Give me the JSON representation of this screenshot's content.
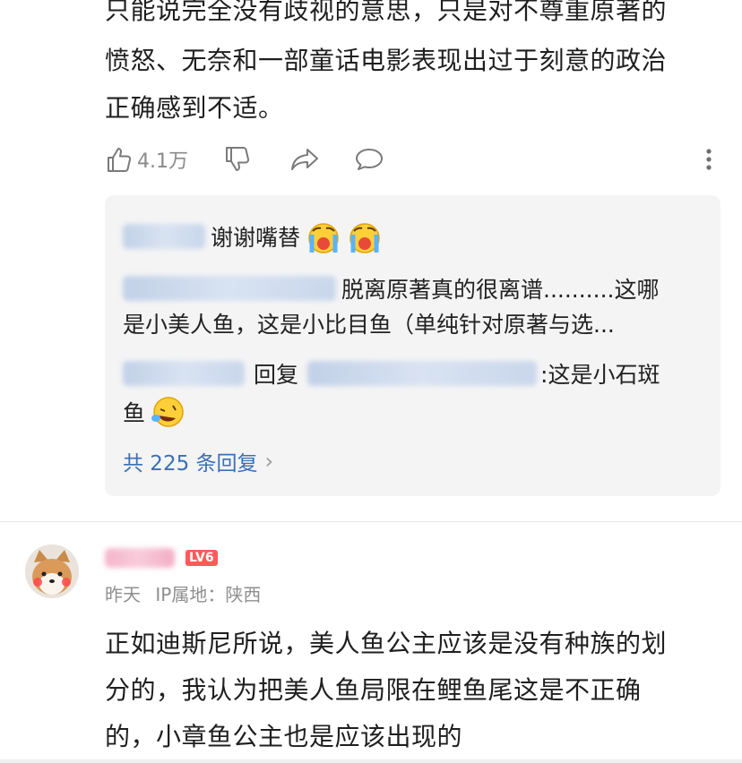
{
  "comment_top": {
    "lines": [
      "只能说完全没有歧视的意思，只是对不尊重原著的",
      "愤怒、无奈和一部童话电影表现出过于刻意的政治",
      "正确感到不适。"
    ],
    "likes": "4.1万"
  },
  "replies": {
    "r1_text": "谢谢嘴替",
    "r2_text_a": "脱离原著真的很离谱..........这哪",
    "r2_text_b": "是小美人鱼，这是小比目鱼（单纯针对原著与选...",
    "r3_reply_word": "回复",
    "r3_text_a": ":这是小石斑",
    "r3_text_b": "鱼",
    "more_label": "共 225 条回复",
    "more_chevron": "›"
  },
  "comment2": {
    "level": "LV6",
    "time": "昨天",
    "ip_label": "IP属地：陕西",
    "lines": [
      "正如迪斯尼所说，美人鱼公主应该是没有种族的划",
      "分的，我认为把美人鱼局限在鲤鱼尾这是不正确",
      "的，小章鱼公主也是应该出现的"
    ]
  },
  "colors": {
    "link": "#3b6fb6",
    "level_badge": "#ff5a5a",
    "reply_bg": "#f4f4f5"
  }
}
